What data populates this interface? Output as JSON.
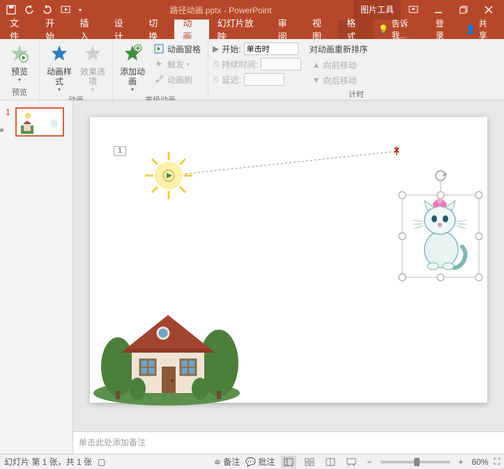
{
  "title": {
    "doc": "路径动画.pptx",
    "app": "PowerPoint",
    "context_tab": "图片工具"
  },
  "qat": {
    "save": "save-icon",
    "undo": "undo-icon",
    "redo": "redo-icon",
    "start": "start-from-beginning-icon"
  },
  "tabs": {
    "file": "文件",
    "home": "开始",
    "insert": "插入",
    "design": "设计",
    "transitions": "切换",
    "animations": "动画",
    "slideshow": "幻灯片放映",
    "review": "审阅",
    "view": "视图",
    "format": "格式",
    "tellme": "告诉我...",
    "signin": "登录",
    "share": "共享"
  },
  "ribbon": {
    "preview": {
      "label": "预览",
      "group": "预览"
    },
    "anim": {
      "styles": "动画样式",
      "effect_options": "效果选项",
      "group": "动画"
    },
    "advanced": {
      "add": "添加动画",
      "pane": "动画窗格",
      "trigger": "触发",
      "painter": "动画刷",
      "group": "高级动画"
    },
    "timing": {
      "start_label": "开始:",
      "start_value": "单击时",
      "duration_label": "持续时间:",
      "duration_value": "",
      "delay_label": "延迟:",
      "delay_value": "",
      "reorder_header": "对动画重新排序",
      "move_earlier": "向前移动",
      "move_later": "向后移动",
      "group": "计时"
    }
  },
  "thumbs": {
    "slide1": "1",
    "star": "★"
  },
  "slide": {
    "anim_index": "1"
  },
  "notes": {
    "placeholder": "单击此处添加备注"
  },
  "status": {
    "slide_info": "幻灯片 第 1 张，共 1 张",
    "notes_btn": "备注",
    "comments_btn": "批注",
    "zoom": "60%"
  }
}
